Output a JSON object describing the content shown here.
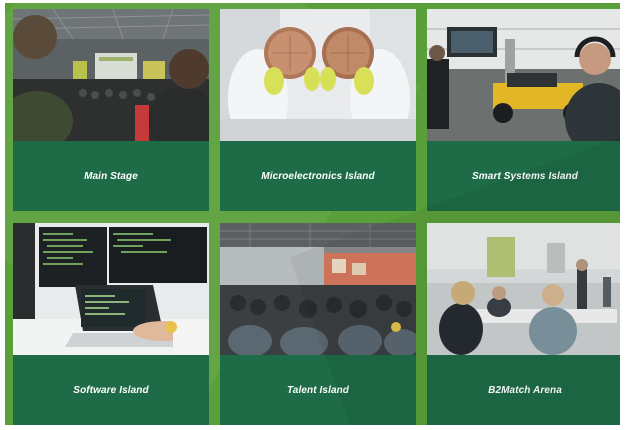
{
  "cards": [
    {
      "label": "Main Stage",
      "photo": "conference-main-stage-audience"
    },
    {
      "label": "Microelectronics Island",
      "photo": "cleanroom-wafer-hands"
    },
    {
      "label": "Smart Systems Island",
      "photo": "robot-vehicle-demo"
    },
    {
      "label": "Software Island",
      "photo": "laptop-coding-monitors"
    },
    {
      "label": "Talent Island",
      "photo": "crowd-session-hall"
    },
    {
      "label": "B2Match Arena",
      "photo": "networking-meeting-table"
    }
  ],
  "colors": {
    "background": "#5aa03a",
    "caption": "#1e6b47",
    "caption_text": "#ffffff"
  }
}
